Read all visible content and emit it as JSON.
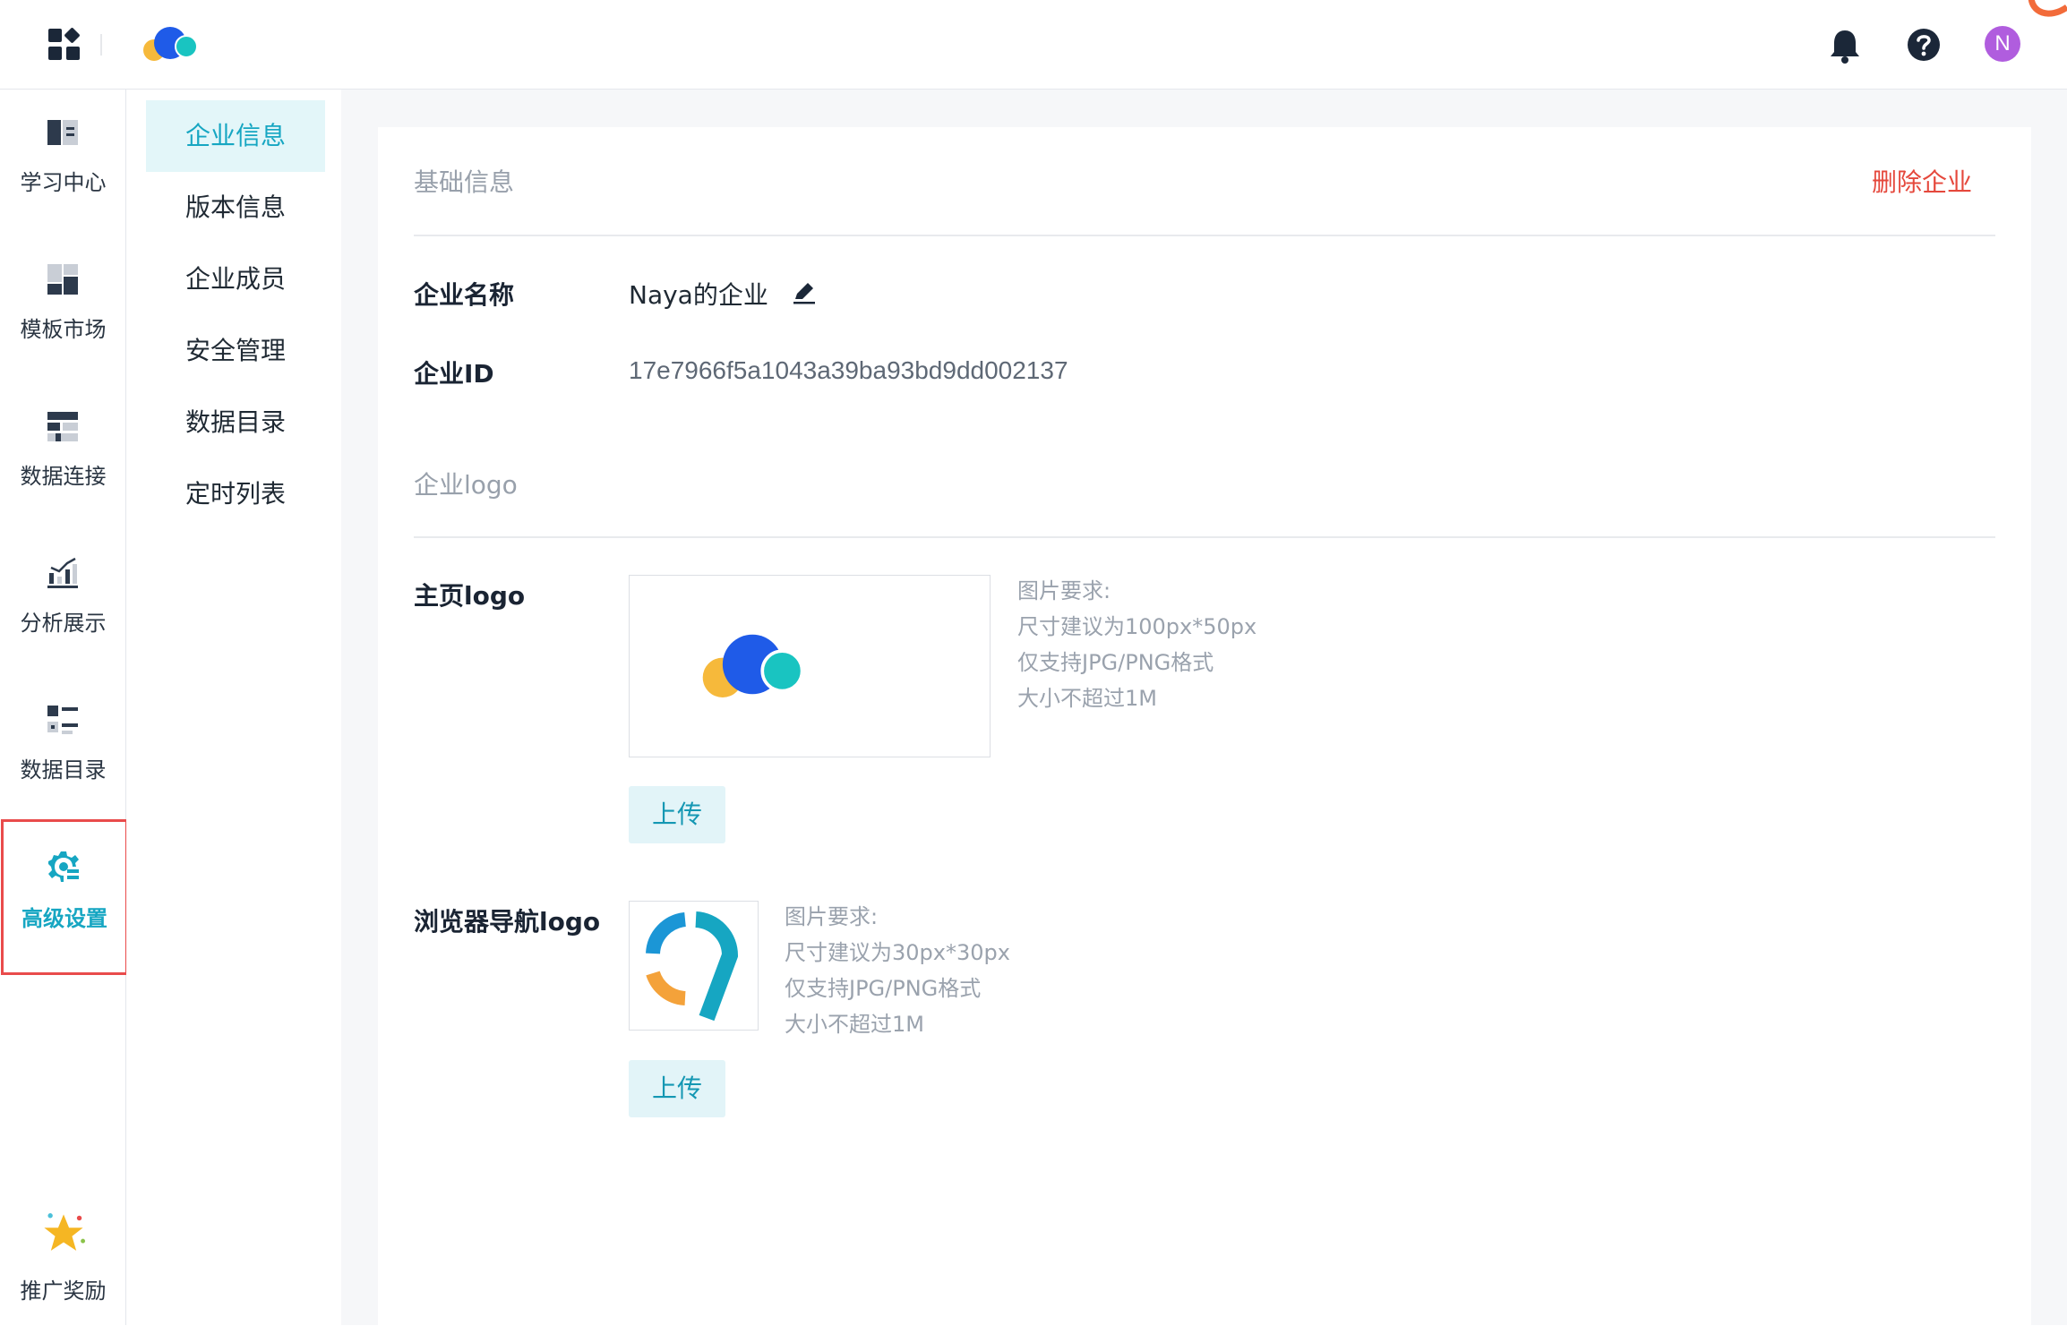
{
  "topbar": {
    "avatar_initial": "N"
  },
  "rail": {
    "items": [
      {
        "label": "学习中心",
        "icon": "book-icon"
      },
      {
        "label": "模板市场",
        "icon": "template-icon"
      },
      {
        "label": "数据连接",
        "icon": "data-connect-icon"
      },
      {
        "label": "分析展示",
        "icon": "chart-icon"
      },
      {
        "label": "数据目录",
        "icon": "catalog-icon"
      },
      {
        "label": "高级设置",
        "icon": "gear-icon"
      }
    ],
    "reward_label": "推广奖励"
  },
  "subnav": {
    "items": [
      "企业信息",
      "版本信息",
      "企业成员",
      "安全管理",
      "数据目录",
      "定时列表"
    ],
    "active": "企业信息"
  },
  "content": {
    "basic_title": "基础信息",
    "delete_label": "删除企业",
    "name_label": "企业名称",
    "name_value": "Naya的企业",
    "id_label": "企业ID",
    "id_value": "17e7966f5a1043a39ba93bd9dd002137",
    "logo_title": "企业logo",
    "home_logo_label": "主页logo",
    "home_logo_req": [
      "图片要求:",
      "尺寸建议为100px*50px",
      "仅支持JPG/PNG格式",
      "大小不超过1M"
    ],
    "upload_label": "上传",
    "browser_logo_label": "浏览器导航logo",
    "browser_logo_req": [
      "图片要求:",
      "尺寸建议为30px*30px",
      "仅支持JPG/PNG格式",
      "大小不超过1M"
    ]
  },
  "colors": {
    "accent": "#16a6c2",
    "danger": "#e5483c",
    "highlight_border": "#e94b4b"
  }
}
